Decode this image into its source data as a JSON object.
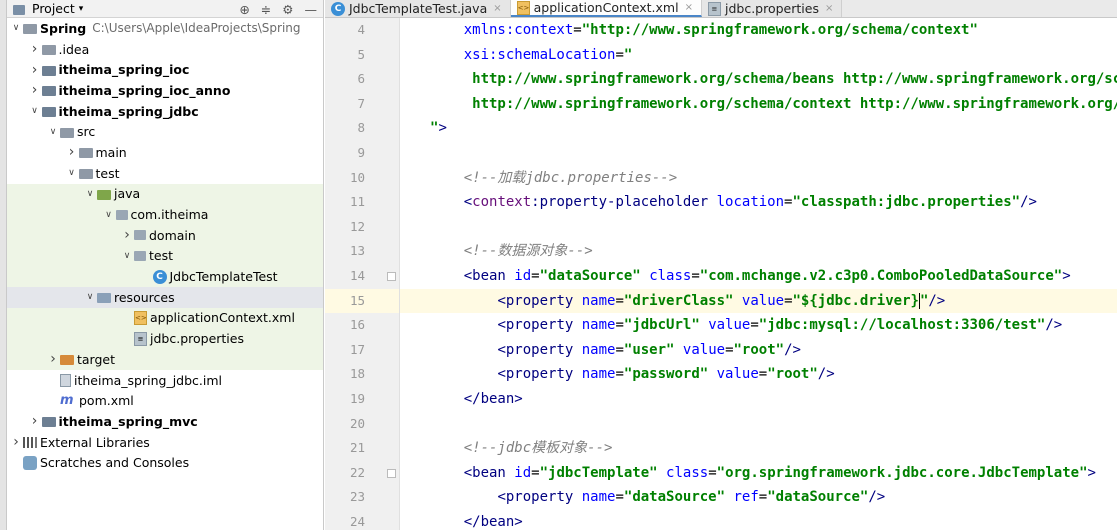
{
  "project_panel": {
    "title": "Project",
    "tree": [
      {
        "label": "Spring",
        "path": "C:\\Users\\Apple\\IdeaProjects\\Spring",
        "indent": 0,
        "arrow": "down",
        "icon": "folder-icon",
        "bold": true
      },
      {
        "label": ".idea",
        "indent": 1,
        "arrow": "right",
        "icon": "folder-icon"
      },
      {
        "label": "itheima_spring_ioc",
        "indent": 1,
        "arrow": "right",
        "icon": "module-folder-icon",
        "bold": true
      },
      {
        "label": "itheima_spring_ioc_anno",
        "indent": 1,
        "arrow": "right",
        "icon": "module-folder-icon",
        "bold": true
      },
      {
        "label": "itheima_spring_jdbc",
        "indent": 1,
        "arrow": "down",
        "icon": "module-folder-icon",
        "bold": true
      },
      {
        "label": "src",
        "indent": 2,
        "arrow": "down",
        "icon": "folder-icon"
      },
      {
        "label": "main",
        "indent": 3,
        "arrow": "right",
        "icon": "folder-icon"
      },
      {
        "label": "test",
        "indent": 3,
        "arrow": "down",
        "icon": "folder-icon"
      },
      {
        "label": "java",
        "indent": 4,
        "arrow": "down",
        "icon": "test-source-folder-icon",
        "tint": true
      },
      {
        "label": "com.itheima",
        "indent": 5,
        "arrow": "down",
        "icon": "package-icon",
        "tint": true
      },
      {
        "label": "domain",
        "indent": 6,
        "arrow": "right",
        "icon": "package-icon",
        "tint": true
      },
      {
        "label": "test",
        "indent": 6,
        "arrow": "down",
        "icon": "package-icon",
        "tint": true
      },
      {
        "label": "JdbcTemplateTest",
        "indent": 7,
        "arrow": "",
        "icon": "class-icon",
        "tint": true
      },
      {
        "label": "resources",
        "indent": 4,
        "arrow": "down",
        "icon": "resources-folder-icon",
        "selected": true
      },
      {
        "label": "applicationContext.xml",
        "indent": 6,
        "arrow": "",
        "icon": "xml-file-icon",
        "tint": true
      },
      {
        "label": "jdbc.properties",
        "indent": 6,
        "arrow": "",
        "icon": "properties-file-icon",
        "tint": true
      },
      {
        "label": "target",
        "indent": 2,
        "arrow": "right",
        "icon": "excluded-folder-icon",
        "tint": true
      },
      {
        "label": "itheima_spring_jdbc.iml",
        "indent": 2,
        "arrow": "",
        "icon": "iml-file-icon"
      },
      {
        "label": "pom.xml",
        "indent": 2,
        "arrow": "",
        "icon": "maven-icon"
      },
      {
        "label": "itheima_spring_mvc",
        "indent": 1,
        "arrow": "right",
        "icon": "module-folder-icon",
        "bold": true
      },
      {
        "label": "External Libraries",
        "indent": 0,
        "arrow": "right",
        "icon": "libraries-icon"
      },
      {
        "label": "Scratches and Consoles",
        "indent": 0,
        "arrow": "",
        "icon": "scratches-icon"
      }
    ]
  },
  "tabs": [
    {
      "label": "JdbcTemplateTest.java",
      "icon": "class-icon",
      "active": false
    },
    {
      "label": "applicationContext.xml",
      "icon": "xml-file-icon",
      "active": true
    },
    {
      "label": "jdbc.properties",
      "icon": "properties-file-icon",
      "active": false
    }
  ],
  "editor": {
    "current_line": 15,
    "lines": [
      {
        "n": 4,
        "segs": [
          [
            "plain",
            "    "
          ],
          [
            "attr",
            "xmlns:context"
          ],
          [
            "plain",
            "="
          ],
          [
            "val",
            "\"http://www.springframework.org/schema/context\""
          ]
        ]
      },
      {
        "n": 5,
        "segs": [
          [
            "plain",
            "    "
          ],
          [
            "attr",
            "xsi:schemaLocation"
          ],
          [
            "plain",
            "="
          ],
          [
            "val",
            "\""
          ]
        ]
      },
      {
        "n": 6,
        "segs": [
          [
            "val",
            "     http://www.springframework.org/schema/beans http://www.springframework.org/schema/beans/spring-beans.xsd"
          ]
        ]
      },
      {
        "n": 7,
        "segs": [
          [
            "val",
            "     http://www.springframework.org/schema/context http://www.springframework.org/schema/context/spring-context.xsd"
          ]
        ]
      },
      {
        "n": 8,
        "segs": [
          [
            "val",
            "\""
          ],
          [
            "tag",
            ">"
          ]
        ]
      },
      {
        "n": 9,
        "segs": []
      },
      {
        "n": 10,
        "segs": [
          [
            "plain",
            "    "
          ],
          [
            "cmt",
            "<!--加载jdbc.properties-->"
          ]
        ]
      },
      {
        "n": 11,
        "segs": [
          [
            "plain",
            "    "
          ],
          [
            "tag",
            "<"
          ],
          [
            "ns",
            "context"
          ],
          [
            "tag",
            ":property-placeholder "
          ],
          [
            "attr",
            "location"
          ],
          [
            "plain",
            "="
          ],
          [
            "val",
            "\"classpath:jdbc.properties\""
          ],
          [
            "tag",
            "/>"
          ]
        ]
      },
      {
        "n": 12,
        "segs": []
      },
      {
        "n": 13,
        "segs": [
          [
            "plain",
            "    "
          ],
          [
            "cmt",
            "<!--数据源对象-->"
          ]
        ]
      },
      {
        "n": 14,
        "segs": [
          [
            "plain",
            "    "
          ],
          [
            "tag",
            "<bean "
          ],
          [
            "attr",
            "id"
          ],
          [
            "plain",
            "="
          ],
          [
            "val",
            "\"dataSource\""
          ],
          [
            "plain",
            " "
          ],
          [
            "attr",
            "class"
          ],
          [
            "plain",
            "="
          ],
          [
            "val",
            "\"com.mchange.v2.c3p0.ComboPooledDataSource\""
          ],
          [
            "tag",
            ">"
          ]
        ]
      },
      {
        "n": 15,
        "segs": [
          [
            "plain",
            "        "
          ],
          [
            "tag",
            "<property "
          ],
          [
            "attr",
            "name"
          ],
          [
            "plain",
            "="
          ],
          [
            "val",
            "\"driverClass\""
          ],
          [
            "plain",
            " "
          ],
          [
            "attr",
            "value"
          ],
          [
            "plain",
            "="
          ],
          [
            "val",
            "\"${jdbc.driver}"
          ],
          [
            "caret",
            ""
          ],
          [
            "val",
            "\""
          ],
          [
            "tag",
            "/>"
          ]
        ]
      },
      {
        "n": 16,
        "segs": [
          [
            "plain",
            "        "
          ],
          [
            "tag",
            "<property "
          ],
          [
            "attr",
            "name"
          ],
          [
            "plain",
            "="
          ],
          [
            "val",
            "\"jdbcUrl\""
          ],
          [
            "plain",
            " "
          ],
          [
            "attr",
            "value"
          ],
          [
            "plain",
            "="
          ],
          [
            "val",
            "\"jdbc:mysql://localhost:3306/test\""
          ],
          [
            "tag",
            "/>"
          ]
        ]
      },
      {
        "n": 17,
        "segs": [
          [
            "plain",
            "        "
          ],
          [
            "tag",
            "<property "
          ],
          [
            "attr",
            "name"
          ],
          [
            "plain",
            "="
          ],
          [
            "val",
            "\"user\""
          ],
          [
            "plain",
            " "
          ],
          [
            "attr",
            "value"
          ],
          [
            "plain",
            "="
          ],
          [
            "val",
            "\"root\""
          ],
          [
            "tag",
            "/>"
          ]
        ]
      },
      {
        "n": 18,
        "segs": [
          [
            "plain",
            "        "
          ],
          [
            "tag",
            "<property "
          ],
          [
            "attr",
            "name"
          ],
          [
            "plain",
            "="
          ],
          [
            "val",
            "\"password\""
          ],
          [
            "plain",
            " "
          ],
          [
            "attr",
            "value"
          ],
          [
            "plain",
            "="
          ],
          [
            "val",
            "\"root\""
          ],
          [
            "tag",
            "/>"
          ]
        ]
      },
      {
        "n": 19,
        "segs": [
          [
            "plain",
            "    "
          ],
          [
            "tag",
            "</bean>"
          ]
        ]
      },
      {
        "n": 20,
        "segs": []
      },
      {
        "n": 21,
        "segs": [
          [
            "plain",
            "    "
          ],
          [
            "cmt",
            "<!--jdbc模板对象-->"
          ]
        ]
      },
      {
        "n": 22,
        "segs": [
          [
            "plain",
            "    "
          ],
          [
            "tag",
            "<bean "
          ],
          [
            "attr",
            "id"
          ],
          [
            "plain",
            "="
          ],
          [
            "val",
            "\"jdbcTemplate\""
          ],
          [
            "plain",
            " "
          ],
          [
            "attr",
            "class"
          ],
          [
            "plain",
            "="
          ],
          [
            "val",
            "\"org.springframework.jdbc.core.JdbcTemplate\""
          ],
          [
            "tag",
            ">"
          ]
        ]
      },
      {
        "n": 23,
        "segs": [
          [
            "plain",
            "        "
          ],
          [
            "tag",
            "<property "
          ],
          [
            "attr",
            "name"
          ],
          [
            "plain",
            "="
          ],
          [
            "val",
            "\"dataSource\""
          ],
          [
            "plain",
            " "
          ],
          [
            "attr",
            "ref"
          ],
          [
            "plain",
            "="
          ],
          [
            "val",
            "\"dataSource\""
          ],
          [
            "tag",
            "/>"
          ]
        ]
      },
      {
        "n": 24,
        "segs": [
          [
            "plain",
            "    "
          ],
          [
            "tag",
            "</bean>"
          ]
        ]
      }
    ],
    "fold_lines": [
      14,
      22
    ],
    "bulb_line": 15
  }
}
